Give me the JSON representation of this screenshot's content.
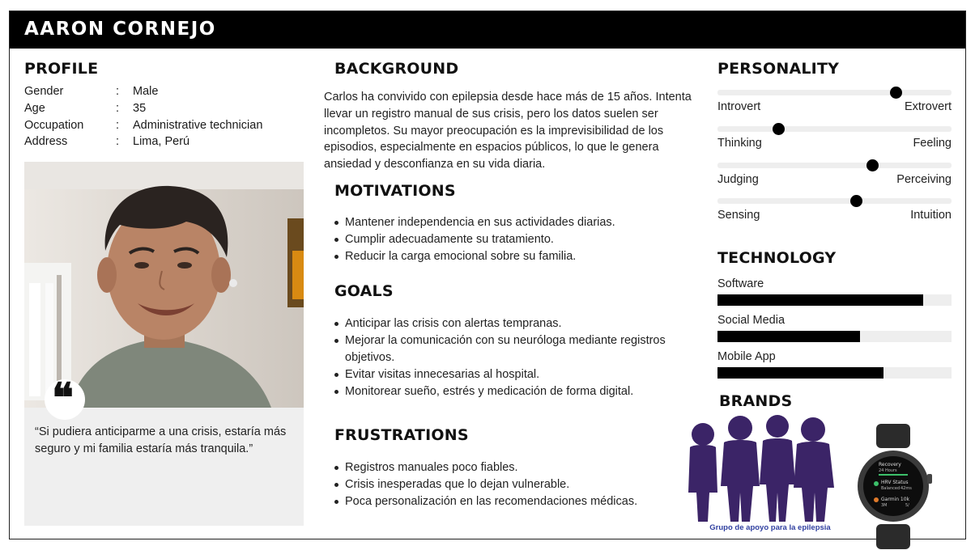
{
  "header": {
    "name": "AARON CORNEJO"
  },
  "profile": {
    "title": "PROFILE",
    "fields": [
      {
        "label": "Gender",
        "value": "Male"
      },
      {
        "label": "Age",
        "value": "35"
      },
      {
        "label": "Occupation",
        "value": "Administrative technician"
      },
      {
        "label": "Address",
        "value": "Lima, Perú"
      }
    ],
    "quote": "“Si pudiera anticiparme a una crisis, estaría más seguro y mi familia estaría más tranquila.”"
  },
  "background": {
    "title": "BACKGROUND",
    "text": "Carlos ha convivido con epilepsia desde hace más de 15 años. Intenta llevar un registro manual de sus crisis, pero los datos suelen ser incompletos. Su mayor preocupación es la imprevisibilidad de los episodios, especialmente en espacios públicos, lo que le genera ansiedad y desconfianza en su vida diaria."
  },
  "motivations": {
    "title": "MOTIVATIONS",
    "items": [
      "Mantener independencia en sus actividades diarias.",
      "Cumplir adecuadamente su tratamiento.",
      "Reducir la carga emocional sobre su familia."
    ]
  },
  "goals": {
    "title": "GOALS",
    "items": [
      "Anticipar las crisis con alertas tempranas.",
      "Mejorar la comunicación con su neuróloga mediante registros objetivos.",
      "Evitar visitas innecesarias al hospital.",
      "Monitorear sueño, estrés y medicación de forma digital."
    ]
  },
  "frustrations": {
    "title": "FRUSTRATIONS",
    "items": [
      "Registros manuales poco fiables.",
      "Crisis inesperadas que lo dejan vulnerable.",
      "Poca personalización en las recomendaciones médicas."
    ]
  },
  "personality": {
    "title": "PERSONALITY",
    "scales": [
      {
        "left": "Introvert",
        "right": "Extrovert",
        "level": 0.76
      },
      {
        "left": "Thinking",
        "right": "Feeling",
        "level": 0.26
      },
      {
        "left": "Judging",
        "right": "Perceiving",
        "level": 0.66
      },
      {
        "left": "Sensing",
        "right": "Intuition",
        "level": 0.59
      }
    ]
  },
  "technology": {
    "title": "TECHNOLOGY",
    "items": [
      {
        "label": "Software",
        "level": 0.88
      },
      {
        "label": "Social Media",
        "level": 0.61
      },
      {
        "label": "Mobile App",
        "level": 0.71
      }
    ]
  },
  "brands": {
    "title": "BRANDS",
    "support_group_caption": "Grupo de apoyo para la epilepsia",
    "watch_screen": {
      "line1": "Recovery",
      "line2": "24 Hours",
      "line3": "HRV Status",
      "line4": "Balanced",
      "line5": "42ms",
      "line6": "Garmin 10k",
      "line7": "3M",
      "line8": "5/"
    }
  },
  "colors": {
    "header_bg": "#000000",
    "support_group_purple": "#3b2467",
    "caption_blue": "#2f3fa0"
  }
}
